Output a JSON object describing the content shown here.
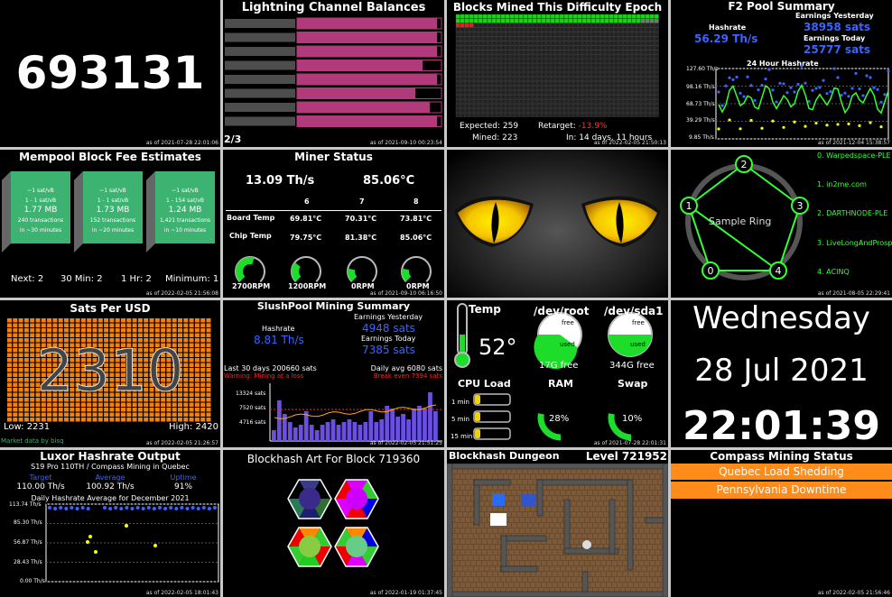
{
  "asof": {
    "block": "as of 2021-07-28 22:01:06",
    "ln": "as of 2021-09-10 00:23:54",
    "epoch": "as of 2022-02-05 21:50:13",
    "f2": "as of 2021-12-04 15:38:57",
    "fees": "as of 2022-02-05 21:56:08",
    "miner": "as of 2021-09-10 06:16:50",
    "ring": "as of 2021-08-05 22:29:41",
    "sats": "as of 2022-02-05 21:26:57",
    "slush": "as of 2022-02-05 21:51:25",
    "sys": "as of 2021-07-28 22:01:31",
    "luxor": "as of 2022-02-05 18:01:43",
    "art": "as of 2022-01-19 01:37:45",
    "compass": "as of 2022-02-05 21:56:46"
  },
  "block_height": {
    "value": "693131"
  },
  "lightning": {
    "title": "Lightning Channel Balances",
    "page": "2/3",
    "balances": [
      0.97,
      0.97,
      0.97,
      0.87,
      0.97,
      0.82,
      0.92,
      0.97
    ]
  },
  "epoch": {
    "title": "Blocks Mined This Difficulty Epoch",
    "expected_label": "Expected:",
    "expected": "259",
    "mined_label": "Mined:",
    "mined": "223",
    "retarget_label": "Retarget:",
    "retarget": "-13.9%",
    "in_text": "In: 14 days, 11 hours"
  },
  "f2": {
    "title": "F2 Pool Summary",
    "hashrate_label": "Hashrate",
    "hashrate": "56.29 Th/s",
    "ey_label": "Earnings Yesterday",
    "ey": "38958 sats",
    "et_label": "Earnings Today",
    "et": "25777 sats",
    "chart_title": "24 Hour Hashrate",
    "yticks": [
      "127.60 Th/s",
      "98.16 Th/s",
      "68.73 Th/s",
      "39.29 Th/s",
      "9.85 Th/s"
    ]
  },
  "fees": {
    "title": "Mempool Block Fee Estimates",
    "blocks": [
      {
        "fee": "~1 sat/vB",
        "range": "1 - 1 sat/vB",
        "size": "1.77 MB",
        "tx": "240 transactions",
        "eta": "in ~30 minutes"
      },
      {
        "fee": "~1 sat/vB",
        "range": "1 - 1 sat/vB",
        "size": "1.73 MB",
        "tx": "152 transactions",
        "eta": "in ~20 minutes"
      },
      {
        "fee": "~1 sat/vB",
        "range": "1 - 154 sat/vB",
        "size": "1.24 MB",
        "tx": "1,421 transactions",
        "eta": "in ~10 minutes"
      }
    ],
    "next": "Next: 2",
    "m30": "30 Min: 2",
    "h1": "1 Hr: 2",
    "min": "Minimum: 1"
  },
  "miner": {
    "title": "Miner Status",
    "hashrate": "13.09 Th/s",
    "temp": "85.06°C",
    "cols": [
      "6",
      "7",
      "8"
    ],
    "board_label": "Board Temp",
    "board": [
      "69.81°C",
      "70.31°C",
      "73.81°C"
    ],
    "chip_label": "Chip Temp",
    "chip": [
      "79.75°C",
      "81.38°C",
      "85.06°C"
    ],
    "fans": [
      {
        "label": "2700RPM",
        "level": 0.45
      },
      {
        "label": "1200RPM",
        "level": 0.2
      },
      {
        "label": "0RPM",
        "level": 0.1
      },
      {
        "label": "0RPM",
        "level": 0.1
      }
    ]
  },
  "ring": {
    "title": "Sample Ring",
    "nodes": [
      "0",
      "1",
      "2",
      "3",
      "4"
    ],
    "names": [
      "0. Warpedspace-PLE",
      "1. in2me.com",
      "2. DARTHNODE-PLE",
      "3. LiveLongAndProsp",
      "4. ACINQ"
    ]
  },
  "sats": {
    "title": "Sats Per USD",
    "value": "2310",
    "low": "Low: 2231",
    "high": "High: 2420",
    "credit": "Market data by bisq"
  },
  "slush": {
    "title": "SlushPool Mining Summary",
    "hashrate_label": "Hashrate",
    "hashrate": "8.81 Th/s",
    "ey_label": "Earnings Yesterday",
    "ey": "4948 sats",
    "et_label": "Earnings Today",
    "et": "7385 sats",
    "last30": "Last 30 days 200660 sats",
    "avg": "Daily avg 6080 sats",
    "warning": "Warning: Mining at a loss",
    "breakeven": "Break even 7394 sats",
    "yticks": [
      "13324 sats",
      "7520 sats",
      "4716 sats"
    ],
    "bars": [
      0.2,
      0.75,
      0.5,
      0.35,
      0.25,
      0.3,
      0.55,
      0.3,
      0.2,
      0.3,
      0.35,
      0.4,
      0.3,
      0.35,
      0.4,
      0.35,
      0.3,
      0.35,
      0.55,
      0.35,
      0.4,
      0.65,
      0.6,
      0.45,
      0.5,
      0.4,
      0.6,
      0.65,
      0.6,
      0.9,
      0.55
    ]
  },
  "sys": {
    "temp_label": "Temp",
    "temp": "52°",
    "root_label": "/dev/root",
    "root_free": "17G free",
    "root_used": 0.6,
    "sda_label": "/dev/sda1",
    "sda_free": "344G free",
    "sda_used": 0.5,
    "free_word": "free",
    "used_word": "used",
    "cpu_label": "CPU Load",
    "cpu_rows": [
      {
        "label": "1 min",
        "level": 0.12
      },
      {
        "label": "5 min",
        "level": 0.12
      },
      {
        "label": "15 min",
        "level": 0.12
      }
    ],
    "ram_label": "RAM",
    "ram": "28%",
    "ram_level": 0.28,
    "swap_label": "Swap",
    "swap": "10%",
    "swap_level": 0.1
  },
  "clock": {
    "day": "Wednesday",
    "date": "28 Jul 2021",
    "time": "22:01:39"
  },
  "luxor": {
    "title": "Luxor Hashrate Output",
    "subtitle": "S19 Pro 110TH / Compass Mining in Quebec",
    "target_label": "Target",
    "target": "110.00 Th/s",
    "avg_label": "Average",
    "avg": "100.92 Th/s",
    "uptime_label": "Uptime",
    "uptime": "91%",
    "chart_title": "Daily Hashrate Average for December 2021",
    "yticks": [
      "113.74 Th/s",
      "85.30 Th/s",
      "56.87 Th/s",
      "28.43 Th/s",
      "0.00 Th/s"
    ]
  },
  "art": {
    "title": "Blockhash Art For Block 719360"
  },
  "dungeon": {
    "title": "Blockhash Dungeon",
    "level": "Level 721952"
  },
  "compass": {
    "title": "Compass Mining Status",
    "items": [
      "Quebec Load Shedding",
      "Pennsylvania Downtime"
    ]
  }
}
